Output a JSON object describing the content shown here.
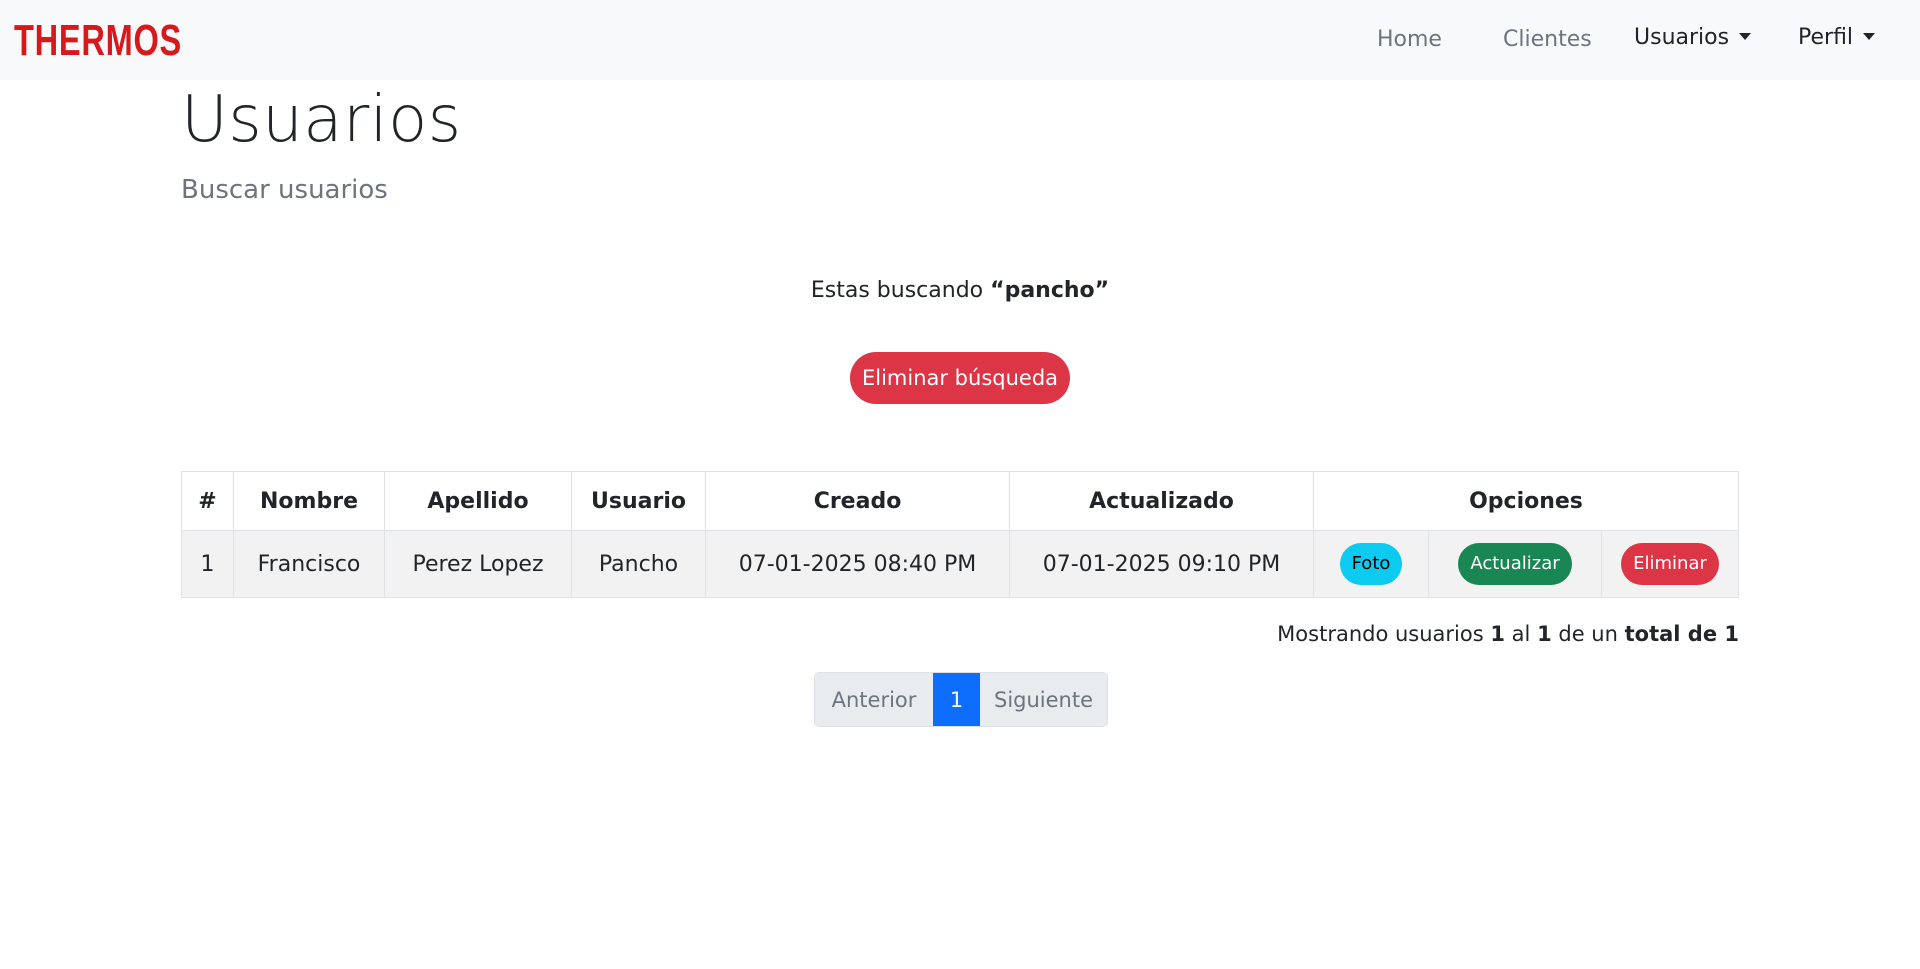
{
  "nav": {
    "brand": "THERMOS",
    "links": [
      "Home",
      "Clientes"
    ],
    "dropdowns": [
      "Usuarios",
      "Perfil"
    ]
  },
  "page": {
    "title": "Usuarios",
    "subtitle": "Buscar usuarios"
  },
  "search": {
    "prefix": "Estas buscando",
    "term": "“pancho”",
    "clear_label": "Eliminar búsqueda"
  },
  "table": {
    "headers": [
      "#",
      "Nombre",
      "Apellido",
      "Usuario",
      "Creado",
      "Actualizado",
      "Opciones"
    ],
    "rows": [
      {
        "num": "1",
        "nombre": "Francisco",
        "apellido": "Perez Lopez",
        "usuario": "Pancho",
        "creado": "07-01-2025 08:40 PM",
        "actualizado": "07-01-2025 09:10 PM",
        "foto": "Foto",
        "actualizar": "Actualizar",
        "eliminar": "Eliminar"
      }
    ]
  },
  "summary": {
    "text1": "Mostrando usuarios",
    "from": "1",
    "text2": "al",
    "to": "1",
    "text3": "de un",
    "total_label": "total de 1"
  },
  "pagination": {
    "prev": "Anterior",
    "current": "1",
    "next": "Siguiente"
  },
  "colors": {
    "brand": "#d7191c",
    "danger": "#dc3545",
    "success": "#198754",
    "info": "#0dcaf0",
    "primary": "#0d6efd"
  }
}
